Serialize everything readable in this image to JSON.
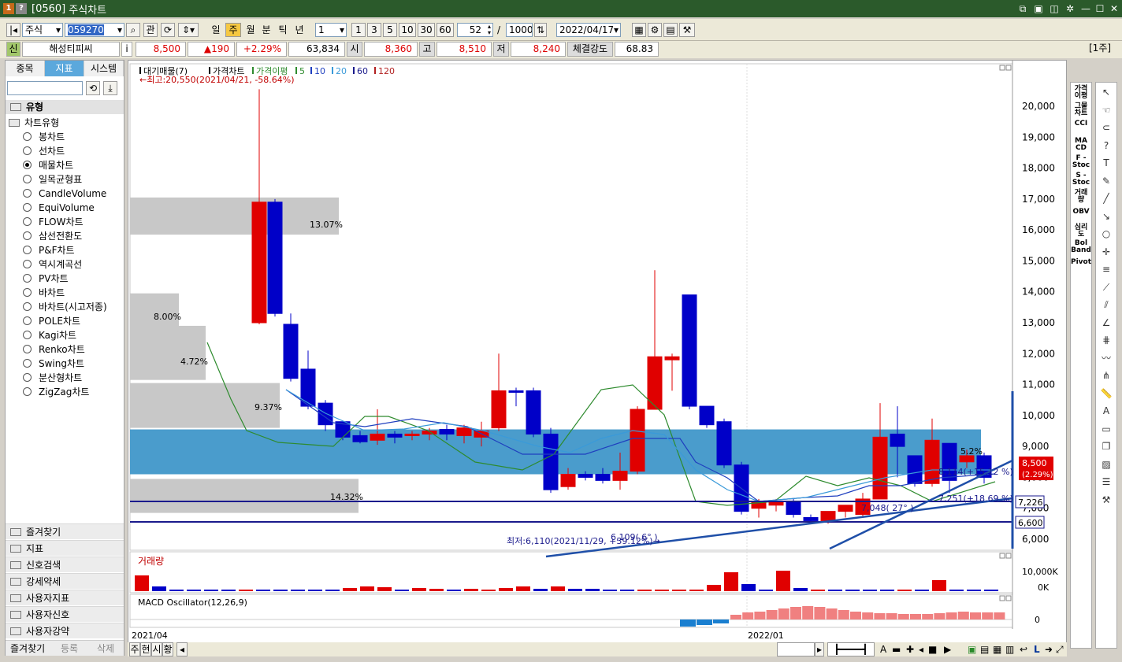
{
  "window": {
    "code": "[0560]",
    "title": "주식차트"
  },
  "toolbar": {
    "market": "주식",
    "code": "059270",
    "btn_gwan": "관",
    "periods": [
      "일",
      "주",
      "월",
      "분",
      "틱",
      "년"
    ],
    "active_period": "주",
    "interval_select": "1",
    "interval_buttons": [
      "1",
      "3",
      "5",
      "10",
      "30",
      "60"
    ],
    "count": "52",
    "count_sep": "/",
    "max_count": "1000",
    "date": "2022/04/17"
  },
  "quote": {
    "badge": "신",
    "name": "해성티피씨",
    "info_btn": "i",
    "price": "8,500",
    "change": "▲190",
    "change_pct": "+2.29%",
    "volume": "63,834",
    "open_label": "시",
    "open": "8,360",
    "high_label": "고",
    "high": "8,510",
    "low_label": "저",
    "low": "8,240",
    "strength_label": "체결강도",
    "strength": "68.83",
    "unit": "[1주]"
  },
  "left": {
    "tabs": [
      "종목",
      "지표",
      "시스템"
    ],
    "active_tab": "지표",
    "section": "유형",
    "subsection": "차트유형",
    "chart_types": [
      "봉차트",
      "선차트",
      "매물차트",
      "일목균형표",
      "CandleVolume",
      "EquiVolume",
      "FLOW차트",
      "삼선전환도",
      "P&F차트",
      "역시계곡선",
      "PV차트",
      "바차트",
      "바차트(시고저종)",
      "POLE차트",
      "Kagi차트",
      "Renko차트",
      "Swing차트",
      "분산형차트",
      "ZigZag차트"
    ],
    "selected_type": "매물차트",
    "groups": [
      "즐겨찾기",
      "지표",
      "신호검색",
      "강세약세",
      "사용자지표",
      "사용자신호",
      "사용자강약"
    ],
    "bottom_tabs": [
      "즐겨찾기",
      "등록",
      "삭제"
    ]
  },
  "chart": {
    "legend_items": [
      {
        "text": "대기매물(7)",
        "color": "#000000"
      },
      {
        "text": "가격차트",
        "color": "#000000"
      },
      {
        "text": "가격이평",
        "color": "#2e8b2e"
      },
      {
        "text": "5",
        "color": "#2e8b2e"
      },
      {
        "text": "10",
        "color": "#1f3fbf"
      },
      {
        "text": "20",
        "color": "#3a9ad9"
      },
      {
        "text": "60",
        "color": "#1a1a8c"
      },
      {
        "text": "120",
        "color": "#b22222"
      }
    ],
    "max_label": "←최고:20,550(2021/04/21, -58.64%)",
    "min_label": "최저:6,110(2021/11/29, +39.12%)→",
    "y_ticks": [
      "20,000",
      "19,000",
      "18,000",
      "17,000",
      "16,000",
      "15,000",
      "14,000",
      "13,000",
      "12,000",
      "11,000",
      "10,000",
      "9,000",
      "8,000",
      "7,000",
      "6,000"
    ],
    "volume_profile_labels": [
      "13.07%",
      "8.00%",
      "4.72%",
      "9.37%",
      "14.32%",
      "5.2%"
    ],
    "price_tags": {
      "current": "8,500",
      "current_pct": "(2.29%)",
      "line1": "7,226",
      "line2": "6,600"
    },
    "trend_annotations": [
      "8,114(+15.12 %)",
      "7,251(+18.69 %)",
      "7,048( 27° )",
      "6,109( 6° )"
    ],
    "volume_title": "거래량",
    "volume_ticks": [
      "10,000K",
      "0K"
    ],
    "macd_title": "MACD Oscillator(12,26,9)",
    "macd_tick": "0",
    "x_labels": [
      "2021/04",
      "2022/01"
    ]
  },
  "chart_data": {
    "type": "candlestick",
    "x": [
      "2021/04",
      "2022/01"
    ],
    "ylim": [
      5600,
      20800
    ],
    "volume_ticks": [
      "0K",
      "10,000K"
    ]
  },
  "rightbar": {
    "items": [
      "가격 이평",
      "그물 차트",
      "CCI",
      "MA CD",
      "F - Stoc",
      "S - Stoc",
      "거래 량",
      "OBV",
      "심리 도",
      "Bol Band",
      "Pivot"
    ]
  },
  "bottom": {
    "tabs": [
      "주",
      "현",
      "시",
      "황"
    ]
  }
}
